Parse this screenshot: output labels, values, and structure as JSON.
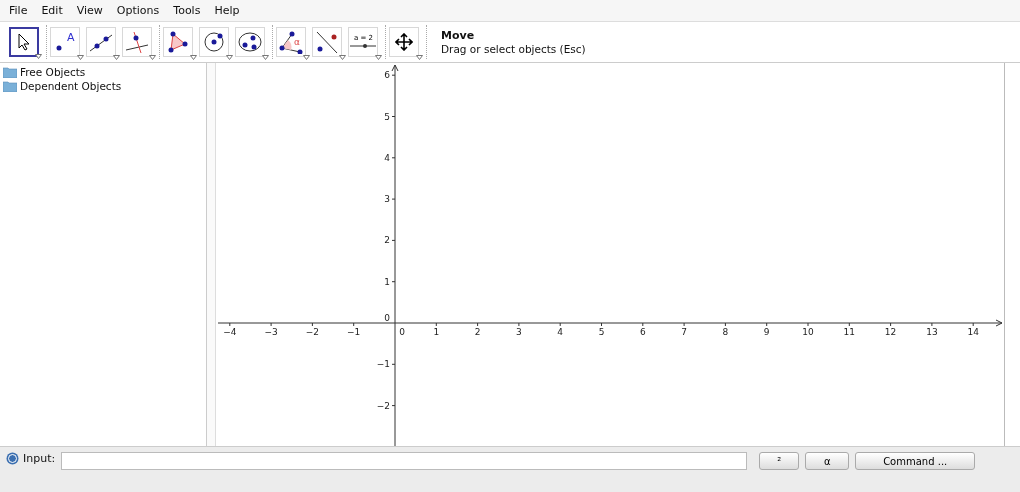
{
  "menu": [
    "File",
    "Edit",
    "View",
    "Options",
    "Tools",
    "Help"
  ],
  "toolbar": {
    "groups": [
      [
        {
          "kind": "move",
          "selected": true
        }
      ],
      [
        {
          "kind": "point",
          "label": "A",
          "selected": false
        },
        {
          "kind": "line",
          "selected": false
        },
        {
          "kind": "perpendicular",
          "selected": false
        }
      ],
      [
        {
          "kind": "polygon",
          "selected": false
        },
        {
          "kind": "circle",
          "selected": false
        },
        {
          "kind": "conic",
          "selected": false
        }
      ],
      [
        {
          "kind": "angle",
          "label": "α",
          "selected": false
        },
        {
          "kind": "reflect",
          "selected": false
        },
        {
          "kind": "slider",
          "label": "a = 2",
          "selected": false
        }
      ],
      [
        {
          "kind": "pan",
          "selected": false
        }
      ]
    ],
    "tool_title": "Move",
    "tool_help": "Drag or select objects (Esc)"
  },
  "algebra": {
    "folders": [
      "Free Objects",
      "Dependent Objects"
    ]
  },
  "graphics": {
    "x_ticks": [
      "−4",
      "−3",
      "−2",
      "−1",
      "0",
      "1",
      "2",
      "3",
      "4",
      "5",
      "6",
      "7",
      "8",
      "9",
      "10",
      "11",
      "12",
      "13",
      "14"
    ],
    "y_ticks": [
      "6",
      "5",
      "4",
      "3",
      "2",
      "1",
      "0",
      "−1",
      "−2"
    ]
  },
  "input_bar": {
    "label": "Input:",
    "buttons": [
      "²",
      "α",
      "Command ..."
    ]
  }
}
